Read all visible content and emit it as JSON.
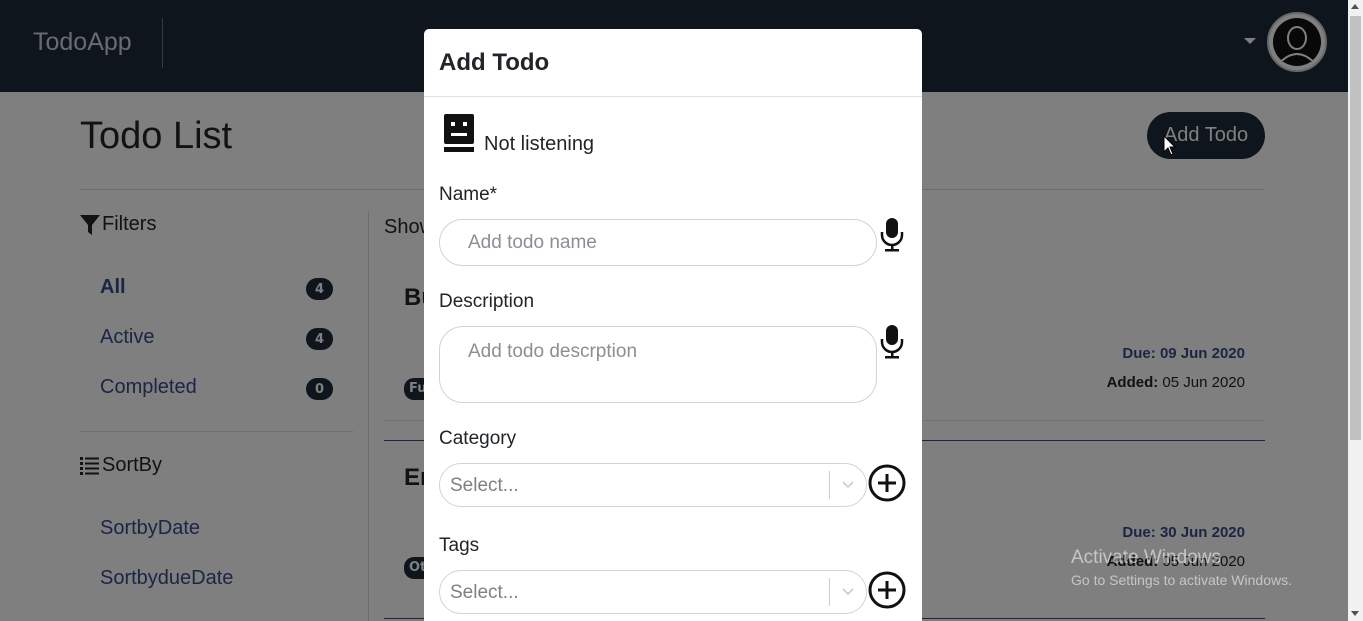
{
  "navbar": {
    "brand": "TodoApp"
  },
  "page": {
    "title": "Todo List",
    "add_button": "Add Todo",
    "filters_title": "Filters",
    "filters": [
      {
        "label": "All",
        "count": "4"
      },
      {
        "label": "Active",
        "count": "4"
      },
      {
        "label": "Completed",
        "count": "0"
      }
    ],
    "sort_title": "SortBy",
    "sort_items": [
      "SortbyDate",
      "SortbydueDate"
    ],
    "show_text": "Show",
    "todos": [
      {
        "title_visible": "Bu",
        "pill": "Fu",
        "due_label": "Due:",
        "due_date": "09 Jun 2020",
        "added_label": "Added:",
        "added_date": "05 Jun 2020"
      },
      {
        "title_visible": "Er",
        "pill": "Ot",
        "due_label": "Due:",
        "due_date": "30 Jun 2020",
        "added_label": "Added:",
        "added_date": "05 Jun 2020"
      }
    ]
  },
  "watermark": {
    "line1": "Activate Windows",
    "line2": "Go to Settings to activate Windows."
  },
  "modal": {
    "title": "Add Todo",
    "status_text": "Not listening",
    "name_label": "Name*",
    "name_placeholder": "Add todo name",
    "description_label": "Description",
    "description_placeholder": "Add todo descrption",
    "category_label": "Category",
    "category_placeholder": "Select...",
    "tags_label": "Tags",
    "tags_placeholder": "Select..."
  }
}
